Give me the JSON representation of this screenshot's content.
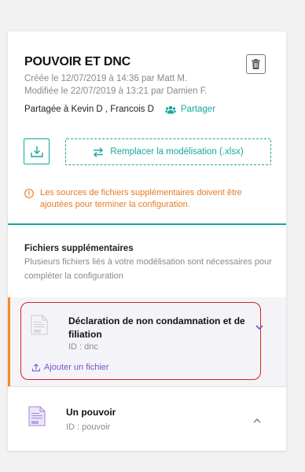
{
  "model": {
    "title": "POUVOIR ET DNC",
    "created": "Créée le 12/07/2019 à 14:36 par Matt M.",
    "modified": "Modifiée le 22/07/2019 à 13:21 par Damien F.",
    "shared_with": "Partagée à Kevin D , Francois D",
    "share_label": "Partager"
  },
  "actions": {
    "replace_label": "Remplacer la modélisation (.xlsx)"
  },
  "warning": {
    "text": "Les sources de fichiers supplémentaires doivent être ajoutées pour terminer la configuration."
  },
  "extra_files": {
    "title": "Fichiers supplémentaires",
    "description": "Plusieurs fichiers liés à votre modélisation sont nécessaires pour compléter la configuration"
  },
  "files": [
    {
      "name": "Déclaration de non condamnation et de filiation",
      "id": "ID : dnc",
      "add_label": "Ajouter un fichier",
      "expanded": true
    },
    {
      "name": "Un pouvoir",
      "id": "ID : pouvoir",
      "expanded": false
    }
  ],
  "colors": {
    "accent": "#15a89e",
    "warning": "#e67a22",
    "link_purple": "#7b52c9",
    "highlight_red": "#d9221f",
    "active_bar": "#f08c1e"
  },
  "icons": {
    "trash": "trash-icon",
    "share": "users-icon",
    "download": "download-icon",
    "replace": "swap-arrows-icon",
    "warning": "warning-circle-icon",
    "document": "document-icon",
    "upload": "upload-icon",
    "chevron_down": "chevron-down-icon",
    "chevron_up": "chevron-up-icon"
  }
}
